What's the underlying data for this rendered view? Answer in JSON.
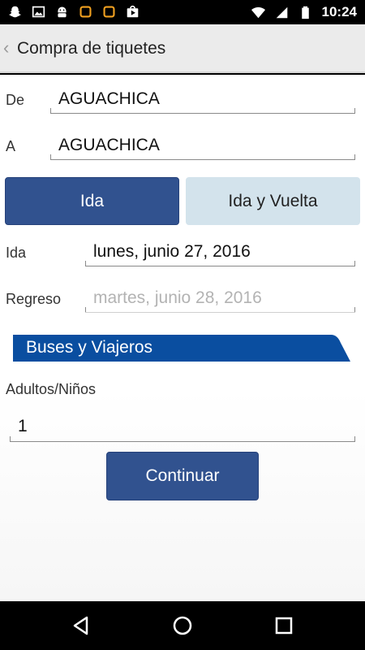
{
  "status_bar": {
    "time": "10:24",
    "left_icons": [
      "snapchat-icon",
      "image-icon",
      "android-icon",
      "square-notification-icon",
      "square-notification-icon",
      "play-store-icon"
    ],
    "right_icons": [
      "wifi-icon",
      "signal-icon",
      "battery-icon"
    ]
  },
  "app_bar": {
    "back": "‹",
    "title": "Compra de tiquetes"
  },
  "form": {
    "from_label": "De",
    "from_value": "AGUACHICA",
    "to_label": "A",
    "to_value": "AGUACHICA",
    "trip_type": {
      "one_way": "Ida",
      "round_trip": "Ida y Vuelta",
      "selected": "Ida"
    },
    "depart_label": "Ida",
    "depart_value": "lunes, junio 27, 2016",
    "return_label": "Regreso",
    "return_placeholder": "martes, junio 28, 2016"
  },
  "section": {
    "title": "Buses y Viajeros"
  },
  "passengers": {
    "label": "Adultos/Niños",
    "value": "1"
  },
  "actions": {
    "continue": "Continuar"
  },
  "colors": {
    "primary": "#31528f",
    "banner": "#0a4ea0",
    "inactive_segment": "#d3e3ec"
  }
}
